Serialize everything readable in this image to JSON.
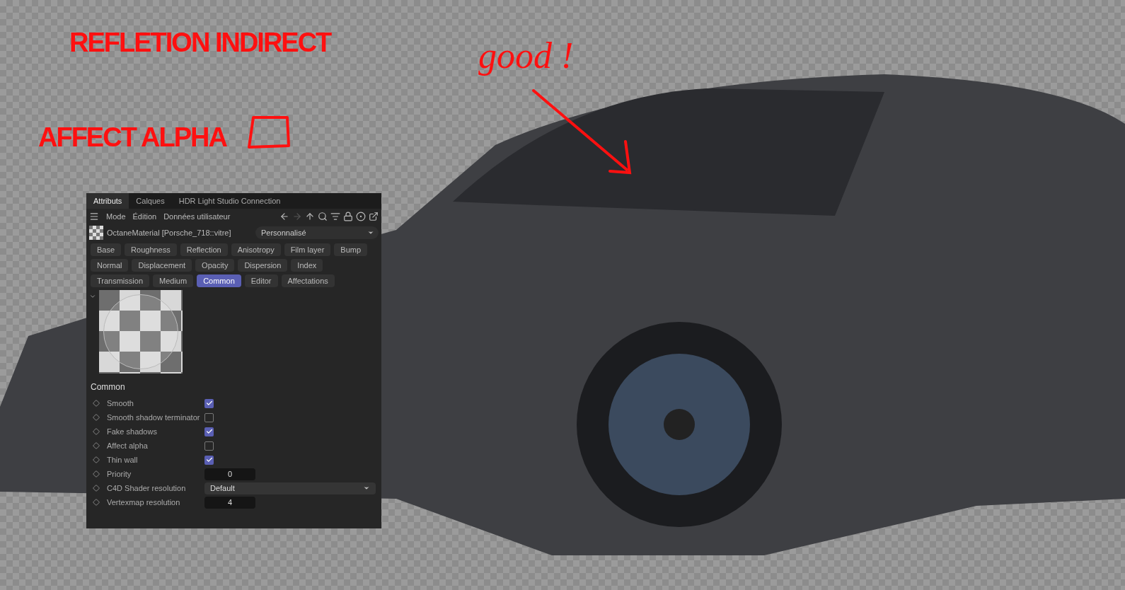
{
  "annotations": {
    "reflection_note": "REFLETION INDIRECT",
    "alpha_note": "AFFECT ALPHA",
    "handwritten_note": "good !"
  },
  "panel": {
    "tabs": [
      {
        "label": "Attributs",
        "selected": true
      },
      {
        "label": "Calques",
        "selected": false
      },
      {
        "label": "HDR Light Studio Connection",
        "selected": false
      }
    ],
    "menu": [
      "Mode",
      "Édition",
      "Données utilisateur"
    ],
    "material": "OctaneMaterial [Porsche_718::vitre]",
    "preset": "Personnalisé",
    "page_rows": [
      [
        {
          "label": "Base",
          "selected": false
        },
        {
          "label": "Roughness",
          "selected": false
        },
        {
          "label": "Reflection",
          "selected": false
        },
        {
          "label": "Anisotropy",
          "selected": false
        },
        {
          "label": "Film layer",
          "selected": false
        },
        {
          "label": "Bump",
          "selected": false
        }
      ],
      [
        {
          "label": "Normal",
          "selected": false
        },
        {
          "label": "Displacement",
          "selected": false
        },
        {
          "label": "Opacity",
          "selected": false
        },
        {
          "label": "Dispersion",
          "selected": false
        },
        {
          "label": "Index",
          "selected": false
        }
      ],
      [
        {
          "label": "Transmission",
          "selected": false
        },
        {
          "label": "Medium",
          "selected": false
        },
        {
          "label": "Common",
          "selected": true
        },
        {
          "label": "Editor",
          "selected": false
        },
        {
          "label": "Affectations",
          "selected": false
        }
      ]
    ],
    "section": "Common",
    "params": [
      {
        "kind": "checkbox",
        "label": "Smooth",
        "checked": true
      },
      {
        "kind": "checkbox",
        "label": "Smooth shadow terminator",
        "checked": false
      },
      {
        "kind": "checkbox",
        "label": "Fake shadows",
        "checked": true
      },
      {
        "kind": "checkbox",
        "label": "Affect alpha",
        "checked": false
      },
      {
        "kind": "checkbox",
        "label": "Thin wall",
        "checked": true
      },
      {
        "kind": "number",
        "label": "Priority",
        "value": "0"
      },
      {
        "kind": "dropdown",
        "label": "C4D Shader resolution",
        "value": "Default"
      },
      {
        "kind": "number",
        "label": "Vertexmap resolution",
        "value": "4"
      }
    ]
  }
}
